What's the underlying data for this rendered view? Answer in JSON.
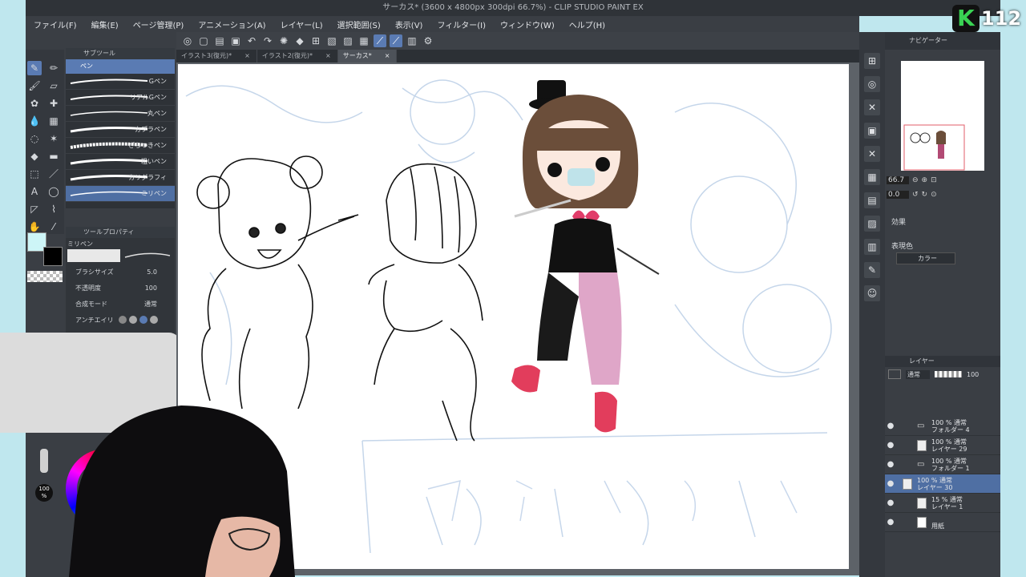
{
  "window": {
    "title": "サーカス* (3600 x 4800px 300dpi 66.7%) - CLIP STUDIO PAINT EX"
  },
  "menu": [
    "ファイル(F)",
    "編集(E)",
    "ページ管理(P)",
    "アニメーション(A)",
    "レイヤー(L)",
    "選択範囲(S)",
    "表示(V)",
    "フィルター(I)",
    "ウィンドウ(W)",
    "ヘルプ(H)"
  ],
  "doc_tabs": [
    {
      "label": "イラスト3(復元)*"
    },
    {
      "label": "イラスト2(復元)*"
    },
    {
      "label": "サーカス*"
    }
  ],
  "subtool": {
    "header": "サブツール",
    "group": "ペン",
    "brushes": [
      "Gペン",
      "リアルGペン",
      "丸ペン",
      "カブラペン",
      "ざらつきペン",
      "粗いペン",
      "カリグラフィ",
      "ミリペン"
    ]
  },
  "tool_property": {
    "header": "ツールプロパティ",
    "brush_name": "ミリペン",
    "brush_size_label": "ブラシサイズ",
    "brush_size_value": "5.0",
    "opacity_label": "不透明度",
    "opacity_value": "100",
    "blend_label": "合成モード",
    "blend_value": "通常",
    "antialias_label": "アンチエイリ"
  },
  "color": {
    "opacity_value": "100",
    "opacity_unit": "%"
  },
  "navigator": {
    "header": "ナビゲーター",
    "zoom": "66.7",
    "rotate": "0.0",
    "effect_header": "効果",
    "expression_label": "表現色",
    "expression_value": "カラー"
  },
  "layers": {
    "header": "レイヤー",
    "blend_mode": "通常",
    "opacity": "100",
    "items": [
      {
        "line1": "100 % 通常",
        "line2": "フォルダー 4"
      },
      {
        "line1": "100 % 通常",
        "line2": "レイヤー 29"
      },
      {
        "line1": "100 % 通常",
        "line2": "フォルダー 1"
      },
      {
        "line1": "100 % 通常",
        "line2": "レイヤー 30"
      },
      {
        "line1": "15 % 通常",
        "line2": "レイヤー 1"
      },
      {
        "line1": "",
        "line2": "用紙"
      }
    ]
  },
  "logo": {
    "text": "112",
    "colors": {
      "k": "#39d353"
    }
  },
  "accent": {
    "selection": "#4f6fa3",
    "ui_dark": "#3a3e44"
  }
}
